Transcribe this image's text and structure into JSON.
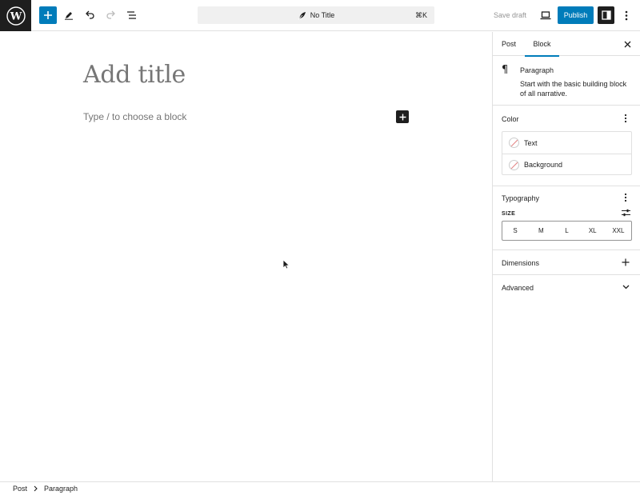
{
  "toolbar": {
    "title": "No Title",
    "shortcut": "⌘K",
    "save_draft": "Save draft",
    "publish": "Publish"
  },
  "editor": {
    "title_placeholder": "Add title",
    "paragraph_placeholder": "Type / to choose a block"
  },
  "sidebar": {
    "tabs": [
      {
        "label": "Post",
        "active": false
      },
      {
        "label": "Block",
        "active": true
      }
    ],
    "block": {
      "name": "Paragraph",
      "description": "Start with the basic building block of all narrative."
    },
    "color": {
      "title": "Color",
      "items": [
        "Text",
        "Background"
      ]
    },
    "typography": {
      "title": "Typography",
      "size_label": "SIZE",
      "sizes": [
        "S",
        "M",
        "L",
        "XL",
        "XXL"
      ]
    },
    "dimensions": {
      "title": "Dimensions"
    },
    "advanced": {
      "title": "Advanced"
    }
  },
  "breadcrumb": [
    "Post",
    "Paragraph"
  ],
  "colors": {
    "accent": "#007cba",
    "dark": "#1e1e1e",
    "border": "#e0e0e0",
    "muted": "#757575"
  }
}
